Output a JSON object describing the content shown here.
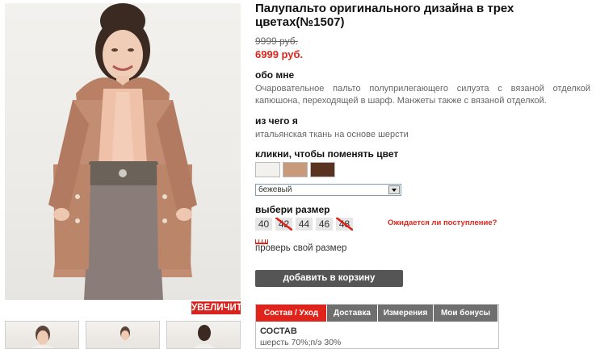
{
  "product": {
    "title": "Палупальто оригинального дизайна в трех цветах(№1507)",
    "old_price": "9999 руб.",
    "new_price": "6999 руб."
  },
  "about": {
    "heading": "обо мне",
    "text": "Очаровательное пальто полуприлегающего силуэта с вязаной отделкой капюшона, переходящей в шарф. Манжеты также с вязаной отделкой."
  },
  "material": {
    "heading": "из чего я",
    "text": "итальянская ткань на основе шерсти"
  },
  "color": {
    "heading": "кликни, чтобы поменять цвет",
    "swatches": [
      "#f2f1ee",
      "#c89a7c",
      "#5a3220"
    ],
    "selected": "бежевый"
  },
  "size": {
    "heading": "выбери размер",
    "options": [
      {
        "label": "40",
        "available": true
      },
      {
        "label": "42",
        "available": false
      },
      {
        "label": "44",
        "available": true
      },
      {
        "label": "46",
        "available": true
      },
      {
        "label": "48",
        "available": false
      }
    ],
    "notify_link": "Ожидается ли поступление?",
    "check_size_link": "проверь свой размер"
  },
  "cart": {
    "add_label": "добавить в корзину"
  },
  "gallery": {
    "zoom_label": "УВЕЛИЧИТЬ",
    "thumb_count": 3
  },
  "tabs": {
    "items": [
      "Состав / Уход",
      "Доставка",
      "Измерения",
      "Мои бонусы"
    ],
    "active": 0,
    "content_heading": "СОСТАВ",
    "content_text": "шерсть 70%;п/э 30%"
  },
  "colors": {
    "accent": "#e0241b",
    "button": "#555555",
    "tab": "#6f6f6f"
  }
}
